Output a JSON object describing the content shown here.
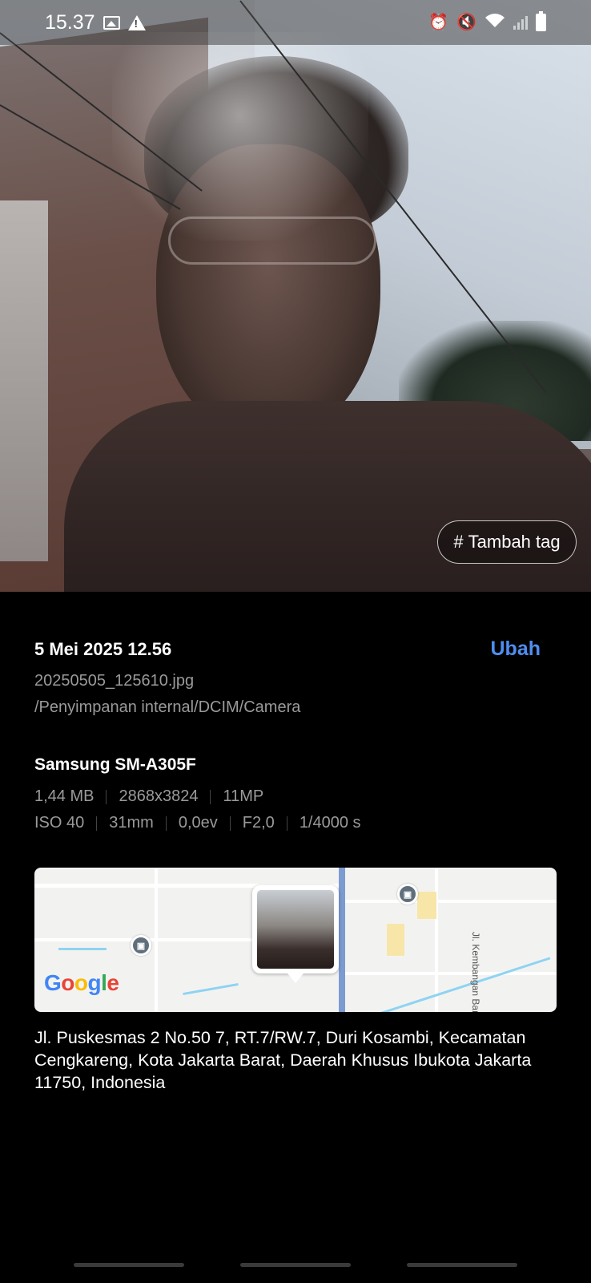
{
  "status_bar": {
    "time": "15.37",
    "left_icons": [
      "image-icon",
      "warning-icon"
    ],
    "right_icons": [
      "alarm-icon",
      "mute-icon",
      "wifi-icon",
      "signal-icon",
      "battery-icon"
    ]
  },
  "photo": {
    "tag_button_label": "Tambah tag",
    "tag_icon": "#"
  },
  "details": {
    "date": "5 Mei 2025 12.56",
    "edit_label": "Ubah",
    "file_name": "20250505_125610.jpg",
    "file_path": "/Penyimpanan internal/DCIM/Camera",
    "device": "Samsung SM-A305F",
    "specs_row1": [
      "1,44 MB",
      "2868x3824",
      "11MP"
    ],
    "specs_row2": [
      "ISO 40",
      "31mm",
      "0,0ev",
      "F2,0",
      "1/4000 s"
    ]
  },
  "map": {
    "street_label": "Jl. Kembangan Baru",
    "logo": [
      "G",
      "o",
      "o",
      "g",
      "l",
      "e"
    ],
    "colors": {
      "main_road": "#7c9bd1",
      "water": "#8fd3f2",
      "transit": "#5f6f7c"
    }
  },
  "address": "Jl. Puskesmas 2 No.50 7, RT.7/RW.7, Duri Kosambi, Kecamatan Cengkareng, Kota Jakarta Barat, Daerah Khusus Ibukota Jakarta 11750, Indonesia",
  "colors": {
    "accent": "#4f8df0",
    "background": "#000000",
    "secondary_text": "#9a9a9a"
  }
}
